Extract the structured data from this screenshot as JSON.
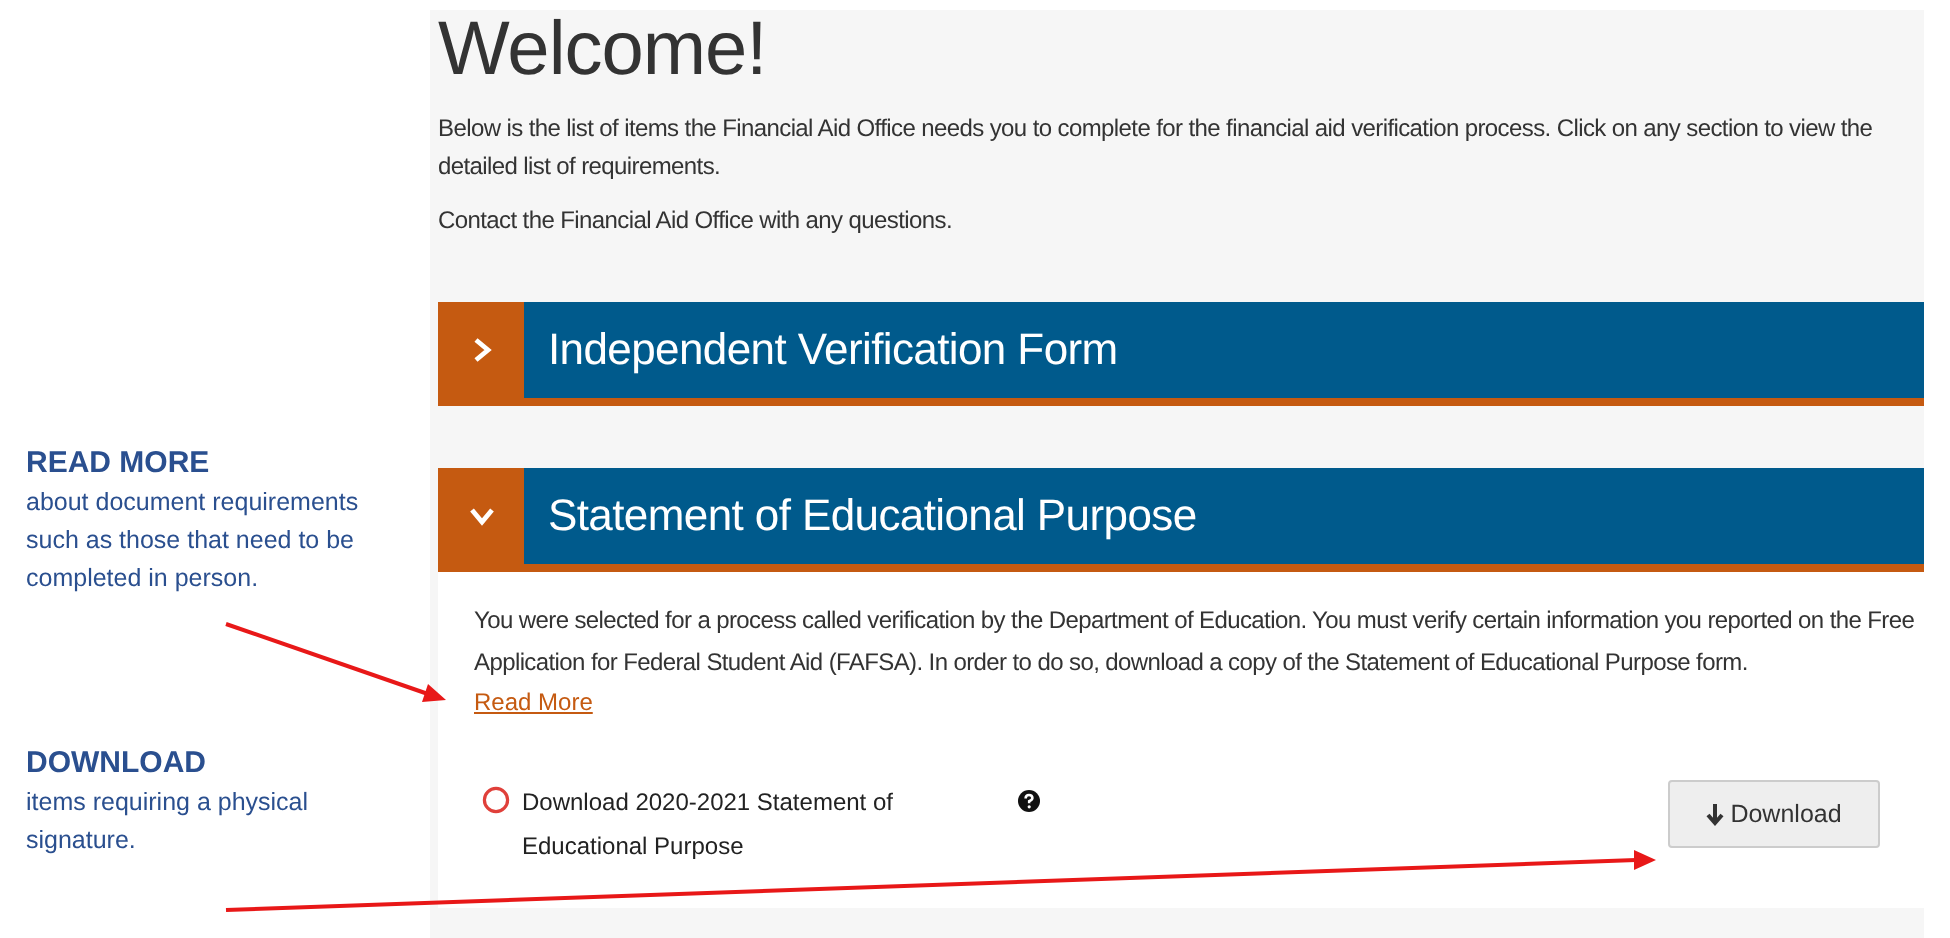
{
  "annotations": [
    {
      "heading": "READ MORE",
      "text": "about document requirements such as those that need to be completed in person."
    },
    {
      "heading": "DOWNLOAD",
      "text": "items requiring a physical signature."
    }
  ],
  "page": {
    "title": "Welcome!",
    "paragraphs": [
      "Below is the list of items the Financial Aid Office needs you to complete for the financial aid verification process. Click on any section to view the detailed list of requirements.",
      "Contact the Financial Aid Office with any questions."
    ]
  },
  "sections": [
    {
      "title": "Independent Verification Form",
      "expanded": false
    },
    {
      "title": "Statement of Educational Purpose",
      "expanded": true,
      "description": "You were selected for a process called verification by the Department of Education. You must verify certain information you reported on the Free Application for Federal Student Aid (FAFSA). In order to do so, download a copy of the Statement of Educational Purpose form.",
      "link": "Read More",
      "items": [
        {
          "label": "Download 2020-2021 Statement of Educational Purpose",
          "button": "Download"
        }
      ]
    }
  ]
}
